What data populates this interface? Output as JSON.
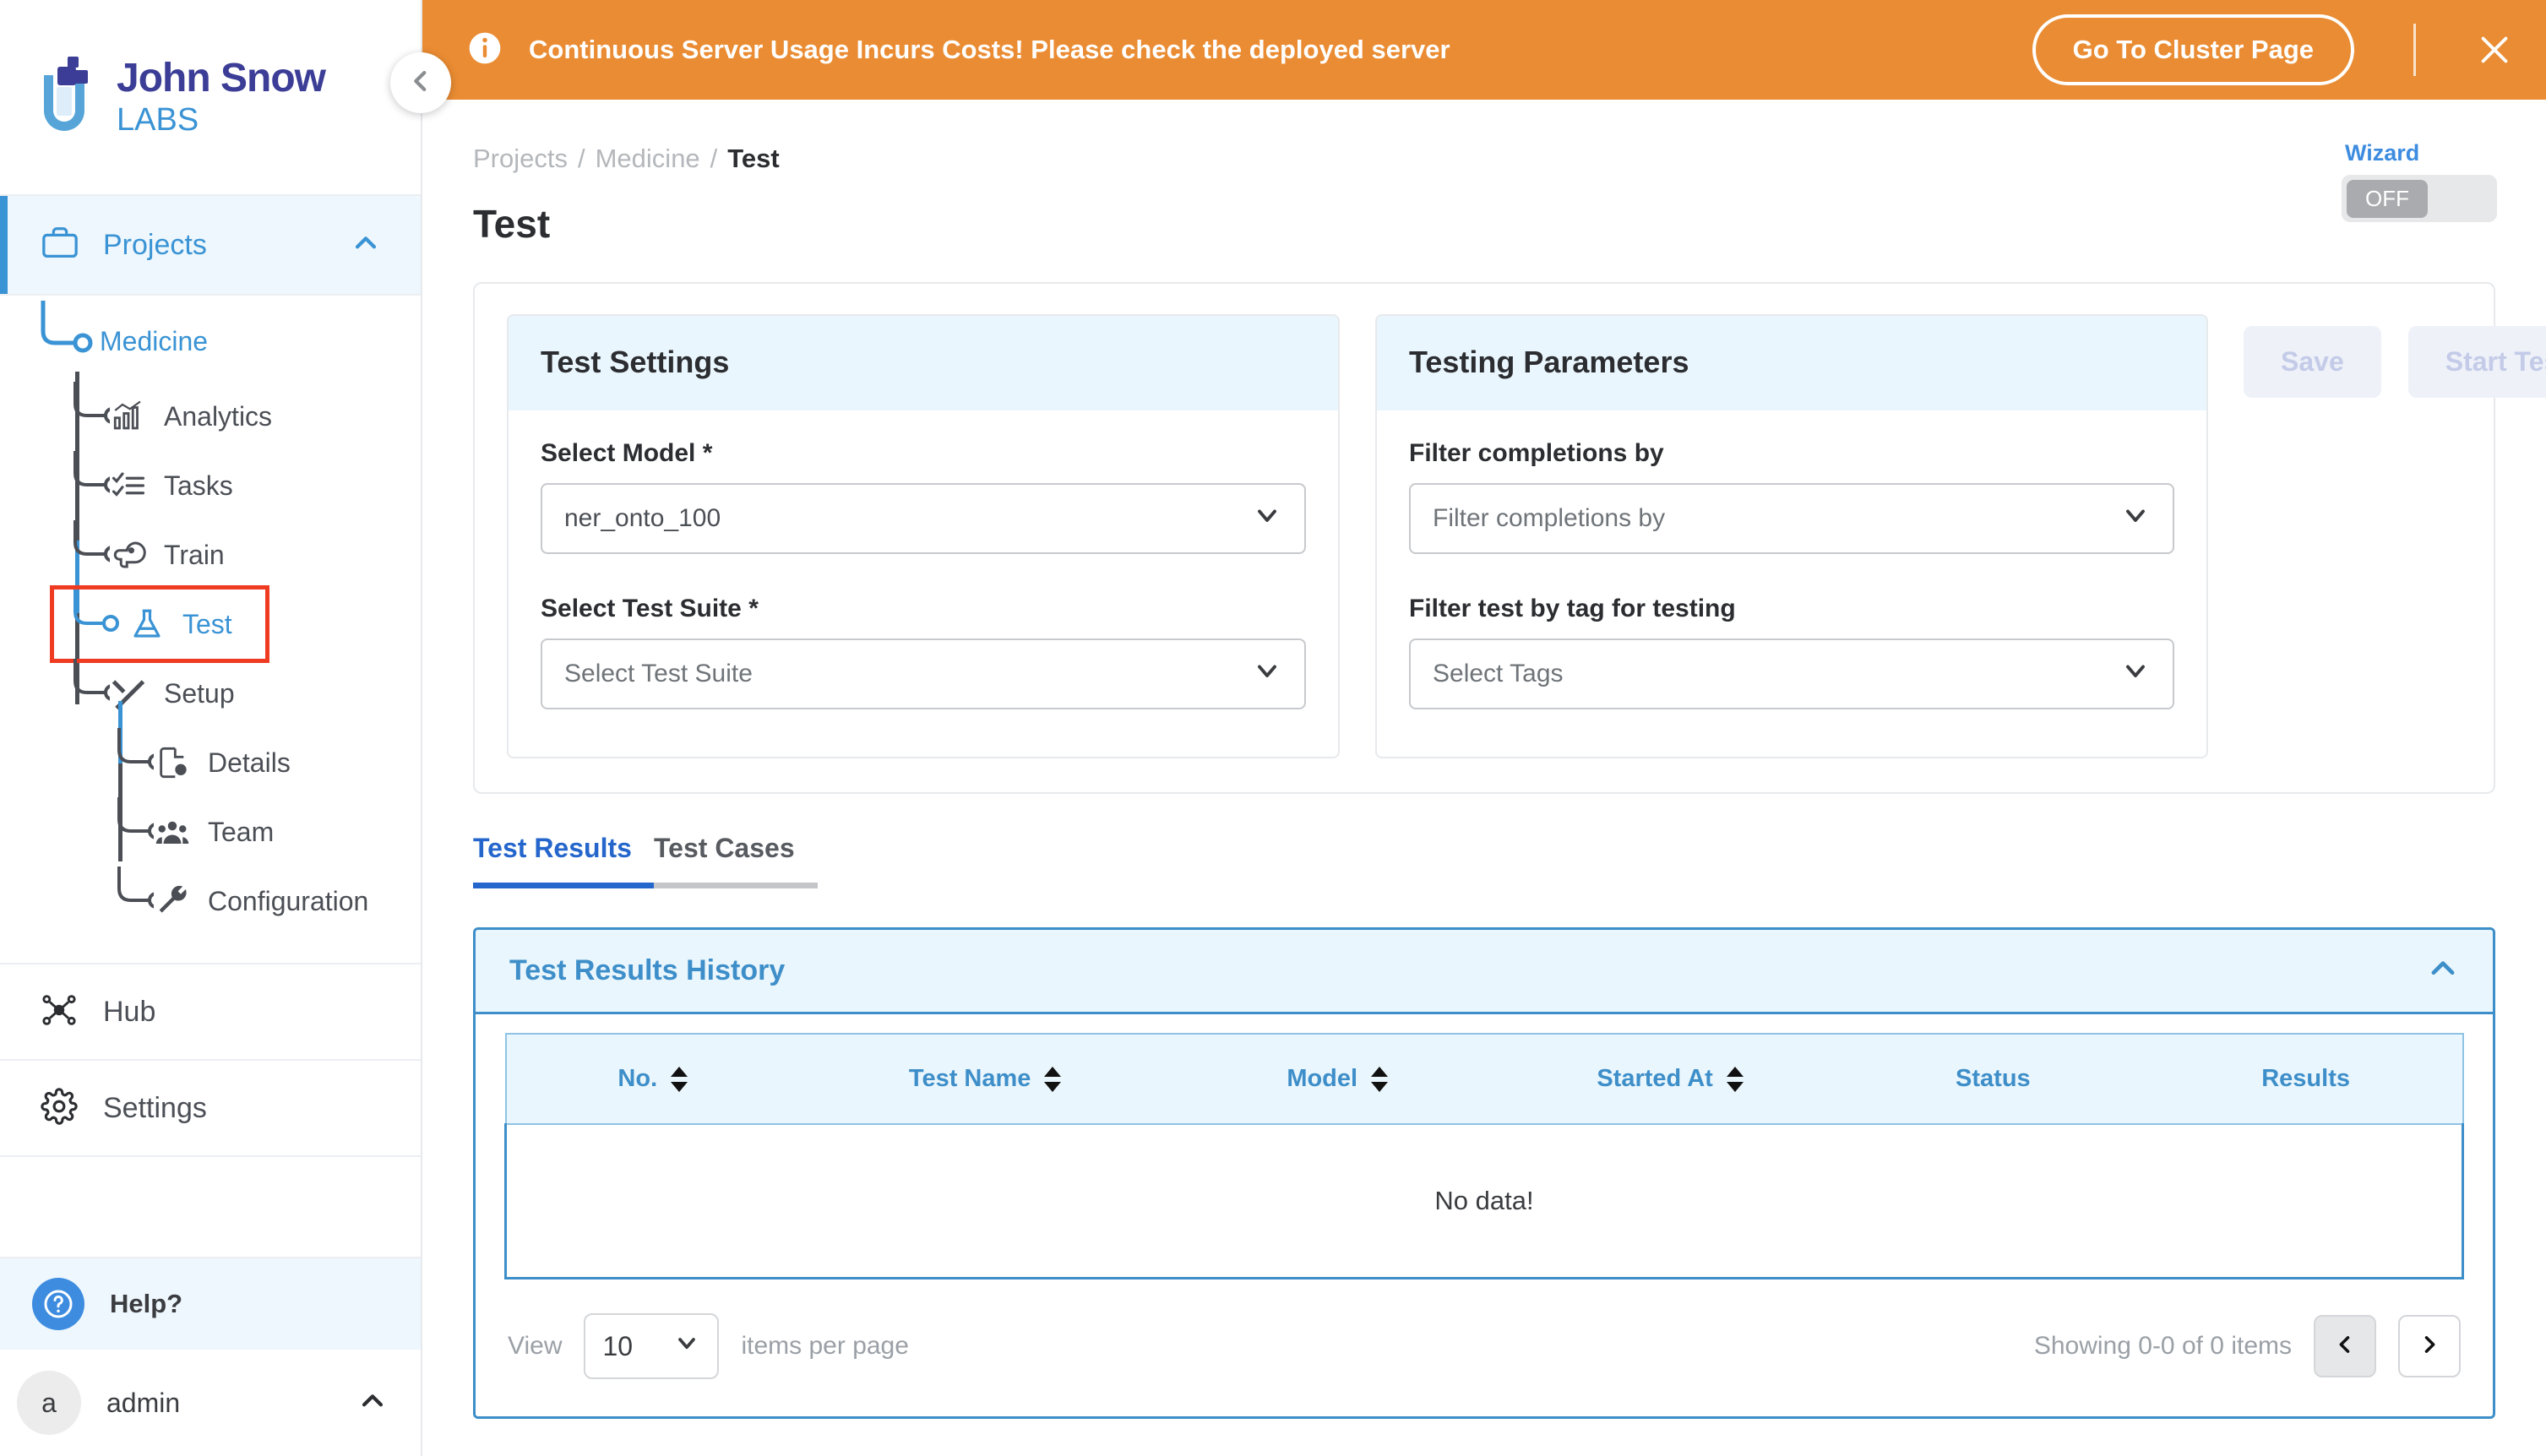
{
  "brand": {
    "name_line1": "John Snow",
    "name_line2": "LABS"
  },
  "banner": {
    "message": "Continuous Server Usage Incurs Costs! Please check the deployed server",
    "cta_label": "Go To Cluster Page",
    "info_icon": "info-icon",
    "close_icon": "close-icon",
    "bg_color": "#ea8c33"
  },
  "sidebar": {
    "collapse_icon": "chevron-left-icon",
    "projects": {
      "label": "Projects",
      "icon": "briefcase-icon",
      "chevron": "chevron-up-icon",
      "active": true
    },
    "project": {
      "label": "Medicine"
    },
    "tree": [
      {
        "label": "Analytics",
        "icon": "analytics-icon",
        "highlighted": false,
        "active": false
      },
      {
        "label": "Tasks",
        "icon": "tasks-icon",
        "highlighted": false,
        "active": false
      },
      {
        "label": "Train",
        "icon": "brain-icon",
        "highlighted": false,
        "active": false
      },
      {
        "label": "Test",
        "icon": "flask-icon",
        "highlighted": true,
        "active": true
      },
      {
        "label": "Setup",
        "icon": "tools-icon",
        "highlighted": false,
        "active": false
      }
    ],
    "setup_children": [
      {
        "label": "Details",
        "icon": "document-info-icon"
      },
      {
        "label": "Team",
        "icon": "team-icon"
      },
      {
        "label": "Configuration",
        "icon": "wrench-icon"
      }
    ],
    "hub": {
      "label": "Hub",
      "icon": "hub-icon"
    },
    "settings": {
      "label": "Settings",
      "icon": "gear-icon"
    },
    "help": {
      "label": "Help?",
      "icon": "question-circle-icon"
    },
    "user": {
      "label": "admin",
      "initial": "a",
      "chevron": "chevron-up-icon"
    }
  },
  "header": {
    "breadcrumb": [
      {
        "label": "Projects",
        "current": false
      },
      {
        "label": "Medicine",
        "current": false
      },
      {
        "label": "Test",
        "current": true
      }
    ],
    "separator": "/",
    "page_title": "Test",
    "wizard": {
      "label": "Wizard",
      "state": "OFF"
    }
  },
  "test_settings": {
    "title": "Test Settings",
    "fields": [
      {
        "label": "Select Model *",
        "value": "ner_onto_100",
        "is_placeholder": false
      },
      {
        "label": "Select Test Suite *",
        "value": "Select Test Suite",
        "is_placeholder": true
      }
    ]
  },
  "testing_parameters": {
    "title": "Testing Parameters",
    "fields": [
      {
        "label": "Filter completions by",
        "value": "Filter completions by",
        "is_placeholder": true
      },
      {
        "label": "Filter test by tag for testing",
        "value": "Select Tags",
        "is_placeholder": true
      }
    ]
  },
  "actions": {
    "save_label": "Save",
    "start_label": "Start Testing",
    "disabled": true
  },
  "tabs": [
    {
      "label": "Test Results",
      "active": true
    },
    {
      "label": "Test Cases",
      "active": false
    }
  ],
  "history": {
    "title": "Test Results History",
    "collapse_icon": "chevron-up-icon",
    "columns": [
      {
        "label": "No.",
        "sortable": true
      },
      {
        "label": "Test Name",
        "sortable": true
      },
      {
        "label": "Model",
        "sortable": true
      },
      {
        "label": "Started At",
        "sortable": true
      },
      {
        "label": "Status",
        "sortable": false
      },
      {
        "label": "Results",
        "sortable": false
      }
    ],
    "rows": [],
    "empty_message": "No data!"
  },
  "pagination": {
    "view_label": "View",
    "per_page_value": "10",
    "items_per_page_label": "items per page",
    "showing_text": "Showing 0-0 of 0 items",
    "prev_icon": "chevron-left-icon",
    "next_icon": "chevron-right-icon",
    "prev_disabled": true
  },
  "colors": {
    "accent_blue": "#3a93d4",
    "tab_blue": "#2566cc",
    "banner_orange": "#ea8c33",
    "highlight_red": "#ef3b22"
  }
}
